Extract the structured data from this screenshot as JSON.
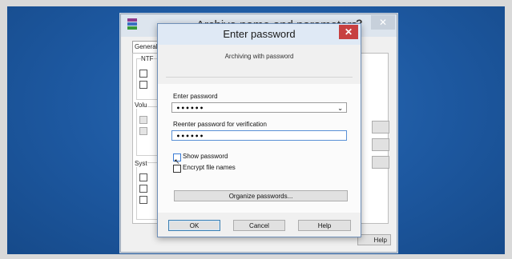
{
  "back_dialog": {
    "title": "Archive name and parameters",
    "help_glyph": "?",
    "close_glyph": "✕",
    "tab_general": "General",
    "group_ntf": "NTF",
    "group_vol": "Volu",
    "group_sys": "Syst",
    "help_button": "Help"
  },
  "password_dialog": {
    "title": "Enter password",
    "close_glyph": "✕",
    "subtitle": "Archiving with password",
    "enter_password_label": "Enter password",
    "enter_password_value": "••••••",
    "reenter_label": "Reenter password for verification",
    "reenter_value": "••••••",
    "show_password_label": "Show password",
    "show_password_checked": false,
    "encrypt_names_label": "Encrypt file names",
    "encrypt_names_checked": false,
    "organize_button": "Organize passwords...",
    "ok_button": "OK",
    "cancel_button": "Cancel",
    "help_button": "Help"
  },
  "icons": {
    "dropdown": "chevron-down-icon",
    "app": "winrar-icon",
    "cursor": "mouse-pointer-icon"
  },
  "colors": {
    "desktop": "#1f5ca3",
    "close_button": "#c74040",
    "focus_border": "#5a91d6"
  }
}
